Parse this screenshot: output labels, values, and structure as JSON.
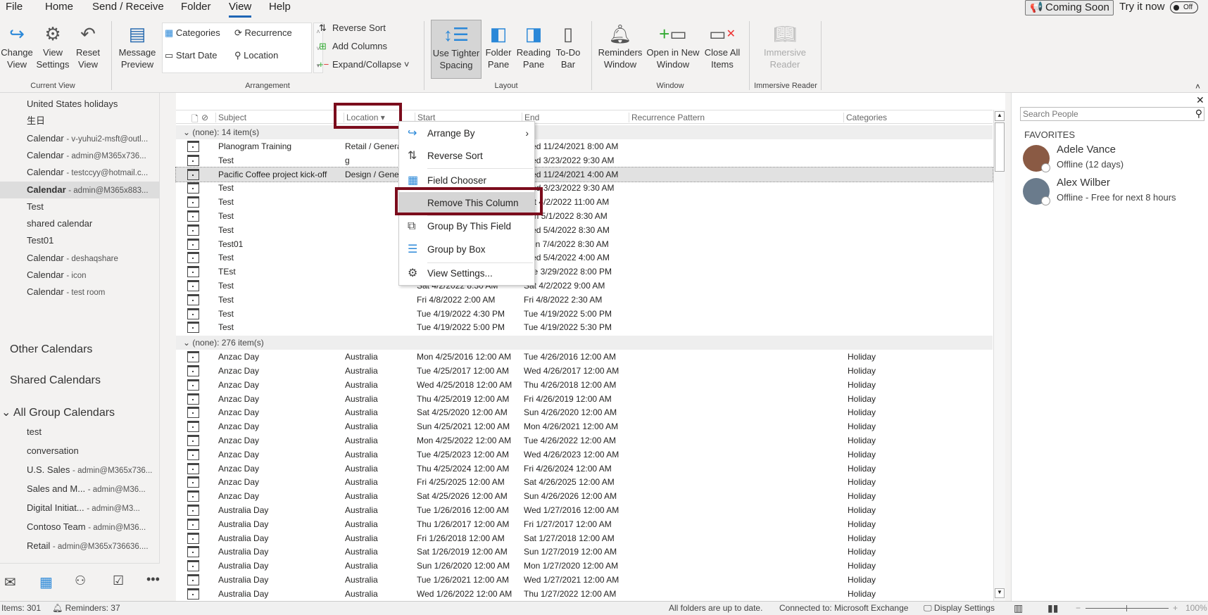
{
  "tabs": [
    "File",
    "Home",
    "Send / Receive",
    "Folder",
    "View",
    "Help"
  ],
  "coming_soon": "Coming Soon",
  "try_it_now": "Try it now",
  "toggle_state": "Off",
  "ribbon": {
    "current_view": {
      "label": "Current View",
      "change_view": "Change View",
      "view_settings": "View Settings",
      "reset_view": "Reset View"
    },
    "arrangement": {
      "label": "Arrangement",
      "message_preview": "Message Preview",
      "categories": "Categories",
      "recurrence": "Recurrence",
      "start_date": "Start Date",
      "location": "Location",
      "reverse_sort": "Reverse Sort",
      "add_columns": "Add Columns",
      "expand_collapse": "Expand/Collapse"
    },
    "layout": {
      "label": "Layout",
      "tighter": "Use Tighter Spacing",
      "folder_pane": "Folder Pane",
      "reading_pane": "Reading Pane",
      "todo_bar": "To-Do Bar"
    },
    "window": {
      "label": "Window",
      "reminders": "Reminders Window",
      "open_new": "Open in New Window",
      "close_all": "Close All Items"
    },
    "immersive": {
      "label": "Immersive Reader",
      "button": "Immersive Reader"
    }
  },
  "sidebar": {
    "items": [
      {
        "name": "United States holidays",
        "sub": ""
      },
      {
        "name": "生日",
        "sub": ""
      },
      {
        "name": "Calendar",
        "sub": "- v-yuhui2-msft@outl..."
      },
      {
        "name": "Calendar",
        "sub": "- admin@M365x736..."
      },
      {
        "name": "Calendar",
        "sub": "- testccyy@hotmail.c..."
      },
      {
        "name": "Calendar",
        "sub": "- admin@M365x883...",
        "selected": true
      },
      {
        "name": "Test",
        "sub": ""
      },
      {
        "name": "shared calendar",
        "sub": ""
      },
      {
        "name": "Test01",
        "sub": ""
      },
      {
        "name": "Calendar",
        "sub": "- deshaqshare"
      },
      {
        "name": "Calendar",
        "sub": "- icon"
      },
      {
        "name": "Calendar",
        "sub": "- test room"
      }
    ],
    "other": "Other Calendars",
    "shared": "Shared Calendars",
    "group": "All Group Calendars",
    "group_items": [
      {
        "name": "test",
        "sub": ""
      },
      {
        "name": "conversation",
        "sub": ""
      },
      {
        "name": "U.S. Sales",
        "sub": "- admin@M365x736..."
      },
      {
        "name": "Sales and M...",
        "sub": "- admin@M36..."
      },
      {
        "name": "Digital Initiat...",
        "sub": "- admin@M3..."
      },
      {
        "name": "Contoso Team",
        "sub": "- admin@M36..."
      },
      {
        "name": "Retail",
        "sub": "- admin@M365x736636...."
      }
    ]
  },
  "table": {
    "headers": {
      "subject": "Subject",
      "location": "Location",
      "start": "Start",
      "end": "End",
      "recurrence": "Recurrence Pattern",
      "categories": "Categories"
    },
    "group1": "(none): 14 item(s)",
    "rows1": [
      [
        "Planogram Training",
        "Retail / General",
        "",
        "Wed 11/24/2021 8:00 AM",
        ""
      ],
      [
        "Test",
        "g",
        "",
        "Wed 3/23/2022 9:30 AM",
        ""
      ],
      [
        "Pacific Coffee project kick-off",
        "Design / General",
        "",
        "Wed 11/24/2021 4:00 AM",
        ""
      ],
      [
        "Test",
        "",
        "",
        "Wed 3/23/2022 9:30 AM",
        ""
      ],
      [
        "Test",
        "",
        "",
        "Sat 4/2/2022 11:00 AM",
        ""
      ],
      [
        "Test",
        "",
        "",
        "Sun 5/1/2022 8:30 AM",
        ""
      ],
      [
        "Test",
        "",
        "",
        "Wed 5/4/2022 8:30 AM",
        ""
      ],
      [
        "Test01",
        "",
        "",
        "Mon 7/4/2022 8:30 AM",
        ""
      ],
      [
        "Test",
        "",
        "",
        "Wed 5/4/2022 4:00 AM",
        ""
      ],
      [
        "TEst",
        "",
        "",
        "Tue 3/29/2022 8:00 PM",
        ""
      ],
      [
        "Test",
        "",
        "Sat 4/2/2022 8:30 AM",
        "Sat 4/2/2022 9:00 AM",
        ""
      ],
      [
        "Test",
        "",
        "Fri 4/8/2022 2:00 AM",
        "Fri 4/8/2022 2:30 AM",
        ""
      ],
      [
        "Test",
        "",
        "Tue 4/19/2022 4:30 PM",
        "Tue 4/19/2022 5:00 PM",
        ""
      ],
      [
        "Test",
        "",
        "Tue 4/19/2022 5:00 PM",
        "Tue 4/19/2022 5:30 PM",
        ""
      ]
    ],
    "group2": "(none): 276 item(s)",
    "rows2": [
      [
        "Anzac Day",
        "Australia",
        "Mon 4/25/2016 12:00 AM",
        "Tue 4/26/2016 12:00 AM",
        "Holiday"
      ],
      [
        "Anzac Day",
        "Australia",
        "Tue 4/25/2017 12:00 AM",
        "Wed 4/26/2017 12:00 AM",
        "Holiday"
      ],
      [
        "Anzac Day",
        "Australia",
        "Wed 4/25/2018 12:00 AM",
        "Thu 4/26/2018 12:00 AM",
        "Holiday"
      ],
      [
        "Anzac Day",
        "Australia",
        "Thu 4/25/2019 12:00 AM",
        "Fri 4/26/2019 12:00 AM",
        "Holiday"
      ],
      [
        "Anzac Day",
        "Australia",
        "Sat 4/25/2020 12:00 AM",
        "Sun 4/26/2020 12:00 AM",
        "Holiday"
      ],
      [
        "Anzac Day",
        "Australia",
        "Sun 4/25/2021 12:00 AM",
        "Mon 4/26/2021 12:00 AM",
        "Holiday"
      ],
      [
        "Anzac Day",
        "Australia",
        "Mon 4/25/2022 12:00 AM",
        "Tue 4/26/2022 12:00 AM",
        "Holiday"
      ],
      [
        "Anzac Day",
        "Australia",
        "Tue 4/25/2023 12:00 AM",
        "Wed 4/26/2023 12:00 AM",
        "Holiday"
      ],
      [
        "Anzac Day",
        "Australia",
        "Thu 4/25/2024 12:00 AM",
        "Fri 4/26/2024 12:00 AM",
        "Holiday"
      ],
      [
        "Anzac Day",
        "Australia",
        "Fri 4/25/2025 12:00 AM",
        "Sat 4/26/2025 12:00 AM",
        "Holiday"
      ],
      [
        "Anzac Day",
        "Australia",
        "Sat 4/25/2026 12:00 AM",
        "Sun 4/26/2026 12:00 AM",
        "Holiday"
      ],
      [
        "Australia Day",
        "Australia",
        "Tue 1/26/2016 12:00 AM",
        "Wed 1/27/2016 12:00 AM",
        "Holiday"
      ],
      [
        "Australia Day",
        "Australia",
        "Thu 1/26/2017 12:00 AM",
        "Fri 1/27/2017 12:00 AM",
        "Holiday"
      ],
      [
        "Australia Day",
        "Australia",
        "Fri 1/26/2018 12:00 AM",
        "Sat 1/27/2018 12:00 AM",
        "Holiday"
      ],
      [
        "Australia Day",
        "Australia",
        "Sat 1/26/2019 12:00 AM",
        "Sun 1/27/2019 12:00 AM",
        "Holiday"
      ],
      [
        "Australia Day",
        "Australia",
        "Sun 1/26/2020 12:00 AM",
        "Mon 1/27/2020 12:00 AM",
        "Holiday"
      ],
      [
        "Australia Day",
        "Australia",
        "Tue 1/26/2021 12:00 AM",
        "Wed 1/27/2021 12:00 AM",
        "Holiday"
      ],
      [
        "Australia Day",
        "Australia",
        "Wed 1/26/2022 12:00 AM",
        "Thu 1/27/2022 12:00 AM",
        "Holiday"
      ]
    ]
  },
  "menu": [
    {
      "label": "Arrange By",
      "icon": "arrange-by-icon",
      "glyph": "↪",
      "submenu": true
    },
    {
      "label": "Reverse Sort",
      "icon": "reverse-sort-icon",
      "glyph": "⇅"
    },
    {
      "label": "Field Chooser",
      "icon": "field-chooser-icon",
      "glyph": "▦"
    },
    {
      "label": "Remove This Column",
      "icon": "",
      "glyph": "",
      "highlighted": true
    },
    {
      "label": "Group By This Field",
      "icon": "group-by-field-icon",
      "glyph": "⧉"
    },
    {
      "label": "Group by Box",
      "icon": "group-by-box-icon",
      "glyph": "☰"
    },
    {
      "label": "View Settings...",
      "icon": "gear-icon",
      "glyph": "⚙"
    }
  ],
  "people": {
    "search_placeholder": "Search People",
    "favorites": "FAVORITES",
    "contacts": [
      {
        "name": "Adele Vance",
        "status": "Offline (12 days)"
      },
      {
        "name": "Alex Wilber",
        "status": "Offline - Free for next 8 hours"
      }
    ]
  },
  "status": {
    "items": "Items: 301",
    "reminders": "Reminders: 37",
    "sync": "All folders are up to date.",
    "connected": "Connected to: Microsoft Exchange",
    "display_settings": "Display Settings",
    "zoom": "100%"
  },
  "colors": {
    "accent": "#1f66b5",
    "highlight_box": "#7b0c1c"
  }
}
